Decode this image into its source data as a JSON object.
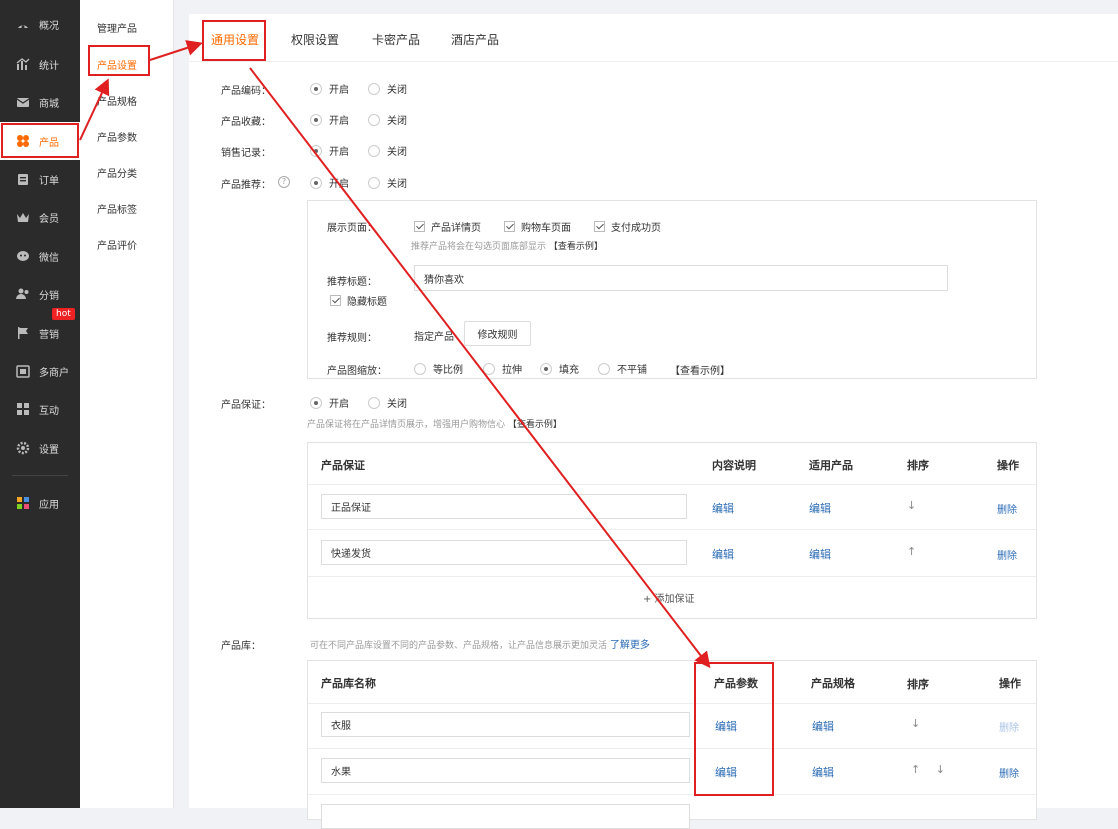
{
  "sidebar": {
    "items": [
      {
        "label": "概况",
        "icon": "dashboard-icon"
      },
      {
        "label": "统计",
        "icon": "chart-icon"
      },
      {
        "label": "商城",
        "icon": "mail-icon"
      },
      {
        "label": "产品",
        "icon": "clover-icon"
      },
      {
        "label": "订单",
        "icon": "clipboard-icon"
      },
      {
        "label": "会员",
        "icon": "crown-icon"
      },
      {
        "label": "微信",
        "icon": "chat-icon"
      },
      {
        "label": "分销",
        "icon": "users-icon"
      },
      {
        "label": "营销",
        "icon": "flag-icon",
        "badge": "hot"
      },
      {
        "label": "多商户",
        "icon": "store-icon"
      },
      {
        "label": "互动",
        "icon": "grid-icon"
      },
      {
        "label": "设置",
        "icon": "gear-icon"
      },
      {
        "label": "应用",
        "icon": "apps-icon"
      }
    ],
    "active_index": 3
  },
  "subnav": {
    "items": [
      "管理产品",
      "产品设置",
      "产品规格",
      "产品参数",
      "产品分类",
      "产品标签",
      "产品评价"
    ],
    "active_index": 1
  },
  "tabs": [
    "通用设置",
    "权限设置",
    "卡密产品",
    "酒店产品"
  ],
  "settings": {
    "open": "开启",
    "close": "关闭",
    "rows": [
      {
        "label": "产品编码：",
        "value": "开启"
      },
      {
        "label": "产品收藏：",
        "value": "开启"
      },
      {
        "label": "销售记录：",
        "value": "开启"
      },
      {
        "label": "产品推荐：",
        "value": "开启"
      }
    ],
    "help_icon": "question-circle-icon"
  },
  "recommend": {
    "display_label": "展示页面：",
    "pages": [
      "产品详情页",
      "购物车页面",
      "支付成功页"
    ],
    "display_hint": "推荐产品将会在勾选页面底部显示",
    "example_link": "【查看示例】",
    "title_label": "推荐标题：",
    "title_value": "猜你喜欢",
    "hide_title": "隐藏标题",
    "rule_label": "推荐规则：",
    "rule_value": "指定产品",
    "rule_button": "修改规则",
    "scale_label": "产品图缩放：",
    "scale_options": [
      "等比例",
      "拉伸",
      "填充",
      "不平铺"
    ],
    "scale_selected": "填充",
    "scale_example": "【查看示例】"
  },
  "guarantee": {
    "label": "产品保证：",
    "hint": "产品保证将在产品详情页展示，增强用户购物信心",
    "example_link": "【查看示例】",
    "columns": [
      "产品保证",
      "内容说明",
      "适用产品",
      "排序",
      "操作"
    ],
    "rows": [
      {
        "name": "正品保证",
        "desc": "编辑",
        "scope": "编辑",
        "sort": "↓",
        "op": "删除"
      },
      {
        "name": "快递发货",
        "desc": "编辑",
        "scope": "编辑",
        "sort": "↑",
        "op": "删除"
      }
    ],
    "add": "+ 添加保证"
  },
  "library": {
    "label": "产品库：",
    "hint": "可在不同产品库设置不同的产品参数、产品规格，让产品信息展示更加灵活",
    "learn_more": "了解更多",
    "columns": [
      "产品库名称",
      "产品参数",
      "产品规格",
      "排序",
      "操作"
    ],
    "rows": [
      {
        "name": "衣服",
        "params": "编辑",
        "specs": "编辑",
        "sort": "↓",
        "op": "删除"
      },
      {
        "name": "水果",
        "params": "编辑",
        "specs": "编辑",
        "sort": "↑ ↓",
        "op": "删除"
      }
    ]
  },
  "colors": {
    "accent": "#ff6a00",
    "annotation": "#e02020",
    "link": "#2a6bb5",
    "sidebar": "#2b2b2b"
  }
}
